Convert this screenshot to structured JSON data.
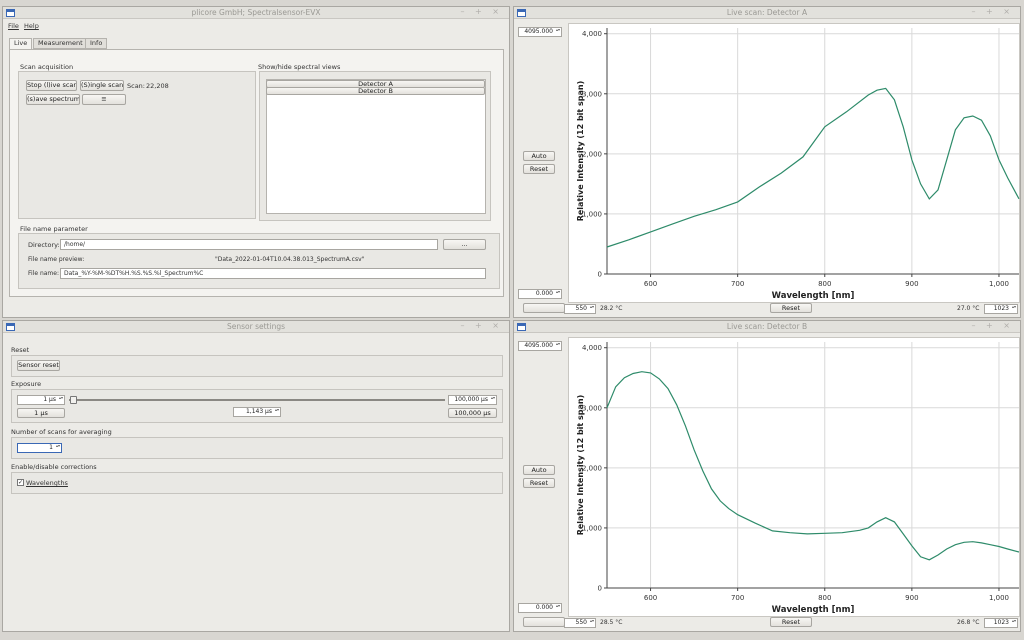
{
  "main_window": {
    "title": "plicore GmbH; Spectralsensor-EVX",
    "menu": [
      "File",
      "Help"
    ],
    "tabs": [
      "Live",
      "Measurement",
      "Info"
    ],
    "scan_group_title": "Scan acquisition",
    "stop_button": "Stop (l)ive scan",
    "single_button": "(S)ingle scan",
    "scan_label": "Scan:",
    "scan_count": "22,208",
    "save_button": "(s)ave spectrum",
    "menu_button": "≡",
    "views_group_title": "Show/hide spectral views",
    "views": [
      "Detector A",
      "Detector B"
    ],
    "file_group_title": "File name parameter",
    "directory_label": "Directory:",
    "directory_value": "/home/",
    "browse_button": "...",
    "preview_label": "File name preview:",
    "preview_value": "\"Data_2022-01-04T10.04.38.013_SpectrumA.csv\"",
    "filename_label": "File name:",
    "filename_value": "Data_%Y-%M-%DT%H.%S.%S.%l_Spectrum%C"
  },
  "sensor_window": {
    "title": "Sensor settings",
    "reset_group": "Reset",
    "sensor_reset_button": "Sensor reset",
    "exposure_group": "Exposure",
    "exposure_min_spin": "1 µs",
    "exposure_max_spin": "100,000 µs",
    "exposure_min_button": "1 µs",
    "exposure_current": "1,143 µs",
    "exposure_max_button": "100,000 µs",
    "exposure_fraction": 0.011,
    "averaging_group": "Number of scans for averaging",
    "averaging_value": "1",
    "corrections_group": "Enable/disable corrections",
    "wavelengths_label": "Wavelengths",
    "wavelengths_checked": true
  },
  "scan_a": {
    "title": "Live scan: Detector A",
    "ymax_spin": "4095.000",
    "ymin_spin": "0.000",
    "auto_button": "Auto",
    "reset_button": "Reset",
    "xmin_spin": "550",
    "temp_left": "28.2 °C",
    "bottom_reset": "Reset",
    "temp_right": "27.0 °C",
    "xmax_spin": "1023"
  },
  "scan_b": {
    "title": "Live scan: Detector B",
    "ymax_spin": "4095.000",
    "ymin_spin": "0.000",
    "auto_button": "Auto",
    "reset_button": "Reset",
    "xmin_spin": "550",
    "temp_left": "28.5 °C",
    "bottom_reset": "Reset",
    "temp_right": "26.8 °C",
    "xmax_spin": "1023"
  },
  "colors": {
    "trace": "#2e8b6a",
    "grid": "#d9d9d9"
  },
  "chart_data": [
    {
      "type": "line",
      "name": "Detector A",
      "xlabel": "Wavelength [nm]",
      "ylabel": "Relative Intensity (12 bit span)",
      "xlim": [
        550,
        1023
      ],
      "ylim": [
        0,
        4095
      ],
      "xticks": [
        {
          "v": 600,
          "t": "600"
        },
        {
          "v": 700,
          "t": "700"
        },
        {
          "v": 800,
          "t": "800"
        },
        {
          "v": 900,
          "t": "900"
        },
        {
          "v": 1000,
          "t": "1,000"
        }
      ],
      "yticks": [
        {
          "v": 0,
          "t": "0"
        },
        {
          "v": 1000,
          "t": "1,000"
        },
        {
          "v": 2000,
          "t": "2,000"
        },
        {
          "v": 3000,
          "t": "3,000"
        },
        {
          "v": 4000,
          "t": "4,000"
        }
      ],
      "grid": true,
      "x": [
        550,
        575,
        600,
        625,
        650,
        675,
        700,
        725,
        750,
        775,
        800,
        825,
        850,
        860,
        870,
        880,
        890,
        900,
        910,
        920,
        930,
        940,
        950,
        960,
        970,
        980,
        990,
        1000,
        1010,
        1023
      ],
      "y": [
        450,
        570,
        700,
        830,
        960,
        1070,
        1200,
        1450,
        1680,
        1950,
        2450,
        2700,
        2980,
        3060,
        3090,
        2900,
        2450,
        1900,
        1500,
        1250,
        1400,
        1900,
        2400,
        2600,
        2630,
        2560,
        2300,
        1900,
        1600,
        1250
      ]
    },
    {
      "type": "line",
      "name": "Detector B",
      "xlabel": "Wavelength [nm]",
      "ylabel": "Relative Intensity (12 bit span)",
      "xlim": [
        550,
        1023
      ],
      "ylim": [
        0,
        4095
      ],
      "xticks": [
        {
          "v": 600,
          "t": "600"
        },
        {
          "v": 700,
          "t": "700"
        },
        {
          "v": 800,
          "t": "800"
        },
        {
          "v": 900,
          "t": "900"
        },
        {
          "v": 1000,
          "t": "1,000"
        }
      ],
      "yticks": [
        {
          "v": 0,
          "t": "0"
        },
        {
          "v": 1000,
          "t": "1,000"
        },
        {
          "v": 2000,
          "t": "2,000"
        },
        {
          "v": 3000,
          "t": "3,000"
        },
        {
          "v": 4000,
          "t": "4,000"
        }
      ],
      "grid": true,
      "x": [
        550,
        560,
        570,
        580,
        590,
        600,
        610,
        620,
        630,
        640,
        650,
        660,
        670,
        680,
        690,
        700,
        720,
        740,
        760,
        780,
        800,
        820,
        840,
        850,
        860,
        870,
        880,
        890,
        900,
        910,
        920,
        930,
        940,
        950,
        960,
        970,
        980,
        990,
        1000,
        1010,
        1023
      ],
      "y": [
        3000,
        3350,
        3500,
        3570,
        3600,
        3580,
        3480,
        3320,
        3050,
        2700,
        2300,
        1950,
        1650,
        1450,
        1320,
        1220,
        1080,
        950,
        920,
        900,
        910,
        920,
        960,
        1000,
        1100,
        1170,
        1100,
        900,
        700,
        520,
        470,
        550,
        650,
        720,
        760,
        770,
        750,
        720,
        690,
        650,
        600
      ]
    }
  ]
}
